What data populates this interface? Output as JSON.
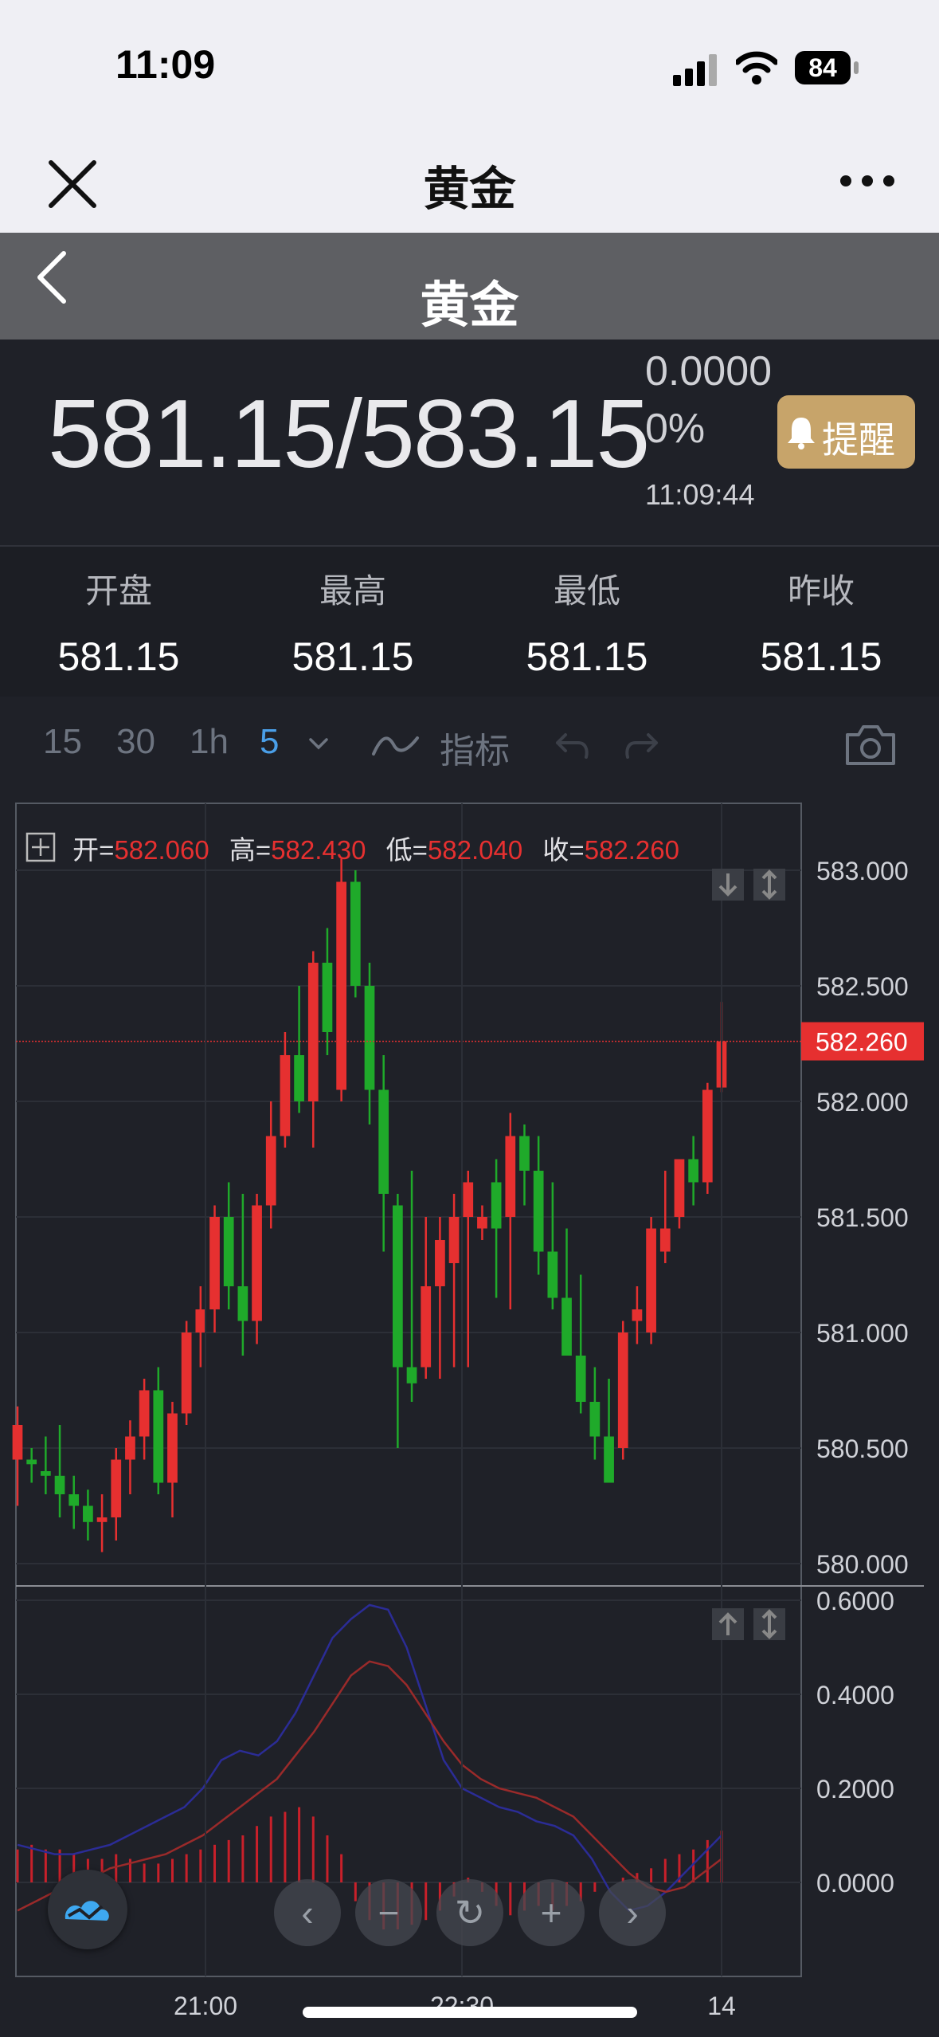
{
  "status": {
    "time": "11:09",
    "battery": "84"
  },
  "nav": {
    "title": "黄金"
  },
  "header": {
    "title": "黄金"
  },
  "quote": {
    "price": "581.15/583.15",
    "change": "0.0000",
    "change_pct": "0%",
    "time": "11:09:44",
    "alert_label": "提醒",
    "alert_color": "#c7a46a"
  },
  "stats": [
    {
      "label": "开盘",
      "value": "581.15"
    },
    {
      "label": "最高",
      "value": "581.15"
    },
    {
      "label": "最低",
      "value": "581.15"
    },
    {
      "label": "昨收",
      "value": "581.15"
    }
  ],
  "toolbar": {
    "intervals": [
      "15",
      "30",
      "1h",
      "5"
    ],
    "active_interval": "5",
    "indicator_label": "指标",
    "active_color": "#4a9fe8"
  },
  "ohlc": {
    "open_label": "开=",
    "open": "582.060",
    "high_label": "高=",
    "high": "582.430",
    "low_label": "低=",
    "low": "582.040",
    "close_label": "收=",
    "close": "582.260"
  },
  "chart_data": [
    {
      "type": "candlestick",
      "ylim": [
        580.0,
        583.1
      ],
      "y_ticks": [
        "583.000",
        "582.500",
        "582.000",
        "581.500",
        "581.000",
        "580.500",
        "580.000"
      ],
      "x_ticks": [
        "21:00",
        "22:30",
        "14"
      ],
      "last_price": "582.260",
      "up_color": "#e63030",
      "down_color": "#1faa2a",
      "candles": [
        [
          580.45,
          580.68,
          580.25,
          580.6
        ],
        [
          580.45,
          580.5,
          580.35,
          580.43
        ],
        [
          580.4,
          580.55,
          580.3,
          580.38
        ],
        [
          580.38,
          580.6,
          580.2,
          580.3
        ],
        [
          580.3,
          580.38,
          580.15,
          580.25
        ],
        [
          580.25,
          580.32,
          580.1,
          580.18
        ],
        [
          580.18,
          580.3,
          580.05,
          580.2
        ],
        [
          580.2,
          580.5,
          580.1,
          580.45
        ],
        [
          580.45,
          580.62,
          580.3,
          580.55
        ],
        [
          580.55,
          580.8,
          580.45,
          580.75
        ],
        [
          580.75,
          580.85,
          580.3,
          580.35
        ],
        [
          580.35,
          580.7,
          580.2,
          580.65
        ],
        [
          580.65,
          581.05,
          580.6,
          581.0
        ],
        [
          581.0,
          581.2,
          580.85,
          581.1
        ],
        [
          581.1,
          581.55,
          581.0,
          581.5
        ],
        [
          581.5,
          581.65,
          581.1,
          581.2
        ],
        [
          581.2,
          581.6,
          580.9,
          581.05
        ],
        [
          581.05,
          581.6,
          580.95,
          581.55
        ],
        [
          581.55,
          582.0,
          581.45,
          581.85
        ],
        [
          581.85,
          582.3,
          581.8,
          582.2
        ],
        [
          582.2,
          582.5,
          581.95,
          582.0
        ],
        [
          582.0,
          582.65,
          581.8,
          582.6
        ],
        [
          582.6,
          582.75,
          582.2,
          582.3
        ],
        [
          582.05,
          583.05,
          582.0,
          582.95
        ],
        [
          582.95,
          583.0,
          582.45,
          582.5
        ],
        [
          582.5,
          582.6,
          581.9,
          582.05
        ],
        [
          582.05,
          582.2,
          581.35,
          581.6
        ],
        [
          581.55,
          581.6,
          580.5,
          580.85
        ],
        [
          580.85,
          581.7,
          580.7,
          580.78
        ],
        [
          580.85,
          581.5,
          580.8,
          581.2
        ],
        [
          581.2,
          581.5,
          580.8,
          581.4
        ],
        [
          581.3,
          581.6,
          580.85,
          581.5
        ],
        [
          581.5,
          581.7,
          580.85,
          581.65
        ],
        [
          581.45,
          581.55,
          581.4,
          581.5
        ],
        [
          581.65,
          581.75,
          581.15,
          581.45
        ],
        [
          581.5,
          581.95,
          581.1,
          581.85
        ],
        [
          581.85,
          581.9,
          581.55,
          581.7
        ],
        [
          581.7,
          581.85,
          581.25,
          581.35
        ],
        [
          581.35,
          581.65,
          581.1,
          581.15
        ],
        [
          581.15,
          581.45,
          580.9,
          580.9
        ],
        [
          580.9,
          581.25,
          580.65,
          580.7
        ],
        [
          580.7,
          580.85,
          580.45,
          580.55
        ],
        [
          580.55,
          580.8,
          580.35,
          580.35
        ],
        [
          580.5,
          581.05,
          580.45,
          581.0
        ],
        [
          581.05,
          581.2,
          580.95,
          581.1
        ],
        [
          581.0,
          581.5,
          580.95,
          581.45
        ],
        [
          581.35,
          581.7,
          581.3,
          581.45
        ],
        [
          581.5,
          581.75,
          581.45,
          581.75
        ],
        [
          581.75,
          581.85,
          581.55,
          581.65
        ],
        [
          581.65,
          582.08,
          581.6,
          582.05
        ],
        [
          582.06,
          582.43,
          582.04,
          582.26
        ]
      ]
    },
    {
      "type": "line",
      "ylim": [
        -0.1,
        0.63
      ],
      "y_ticks": [
        "0.6000",
        "0.4000",
        "0.2000",
        "0.0000"
      ],
      "series": [
        {
          "color": "#2b2c96",
          "values": [
            0.08,
            0.07,
            0.06,
            0.06,
            0.07,
            0.08,
            0.1,
            0.12,
            0.14,
            0.16,
            0.2,
            0.26,
            0.28,
            0.27,
            0.3,
            0.36,
            0.44,
            0.52,
            0.56,
            0.59,
            0.58,
            0.5,
            0.38,
            0.26,
            0.2,
            0.18,
            0.16,
            0.15,
            0.13,
            0.12,
            0.1,
            0.05,
            -0.02,
            -0.06,
            -0.05,
            -0.02,
            0.02,
            0.06,
            0.1
          ]
        },
        {
          "color": "#9a2a2a",
          "values": [
            -0.06,
            -0.04,
            -0.02,
            0.0,
            0.01,
            0.03,
            0.04,
            0.05,
            0.06,
            0.08,
            0.1,
            0.13,
            0.16,
            0.19,
            0.22,
            0.27,
            0.32,
            0.38,
            0.44,
            0.47,
            0.46,
            0.42,
            0.36,
            0.3,
            0.25,
            0.22,
            0.2,
            0.19,
            0.18,
            0.16,
            0.14,
            0.1,
            0.06,
            0.02,
            -0.01,
            -0.02,
            -0.01,
            0.02,
            0.05
          ]
        }
      ],
      "histogram": [
        0.07,
        0.08,
        0.07,
        0.07,
        0.06,
        0.05,
        0.05,
        0.06,
        0.05,
        0.04,
        0.04,
        0.05,
        0.06,
        0.07,
        0.08,
        0.09,
        0.1,
        0.12,
        0.14,
        0.15,
        0.16,
        0.14,
        0.1,
        0.06,
        -0.04,
        -0.08,
        -0.1,
        -0.1,
        -0.09,
        -0.08,
        -0.06,
        -0.03,
        0.01,
        -0.02,
        -0.05,
        -0.07,
        -0.06,
        -0.05,
        -0.06,
        -0.05,
        -0.04,
        -0.02,
        0.0,
        0.01,
        0.02,
        0.03,
        0.05,
        0.06,
        0.07,
        0.09,
        0.11
      ]
    }
  ]
}
